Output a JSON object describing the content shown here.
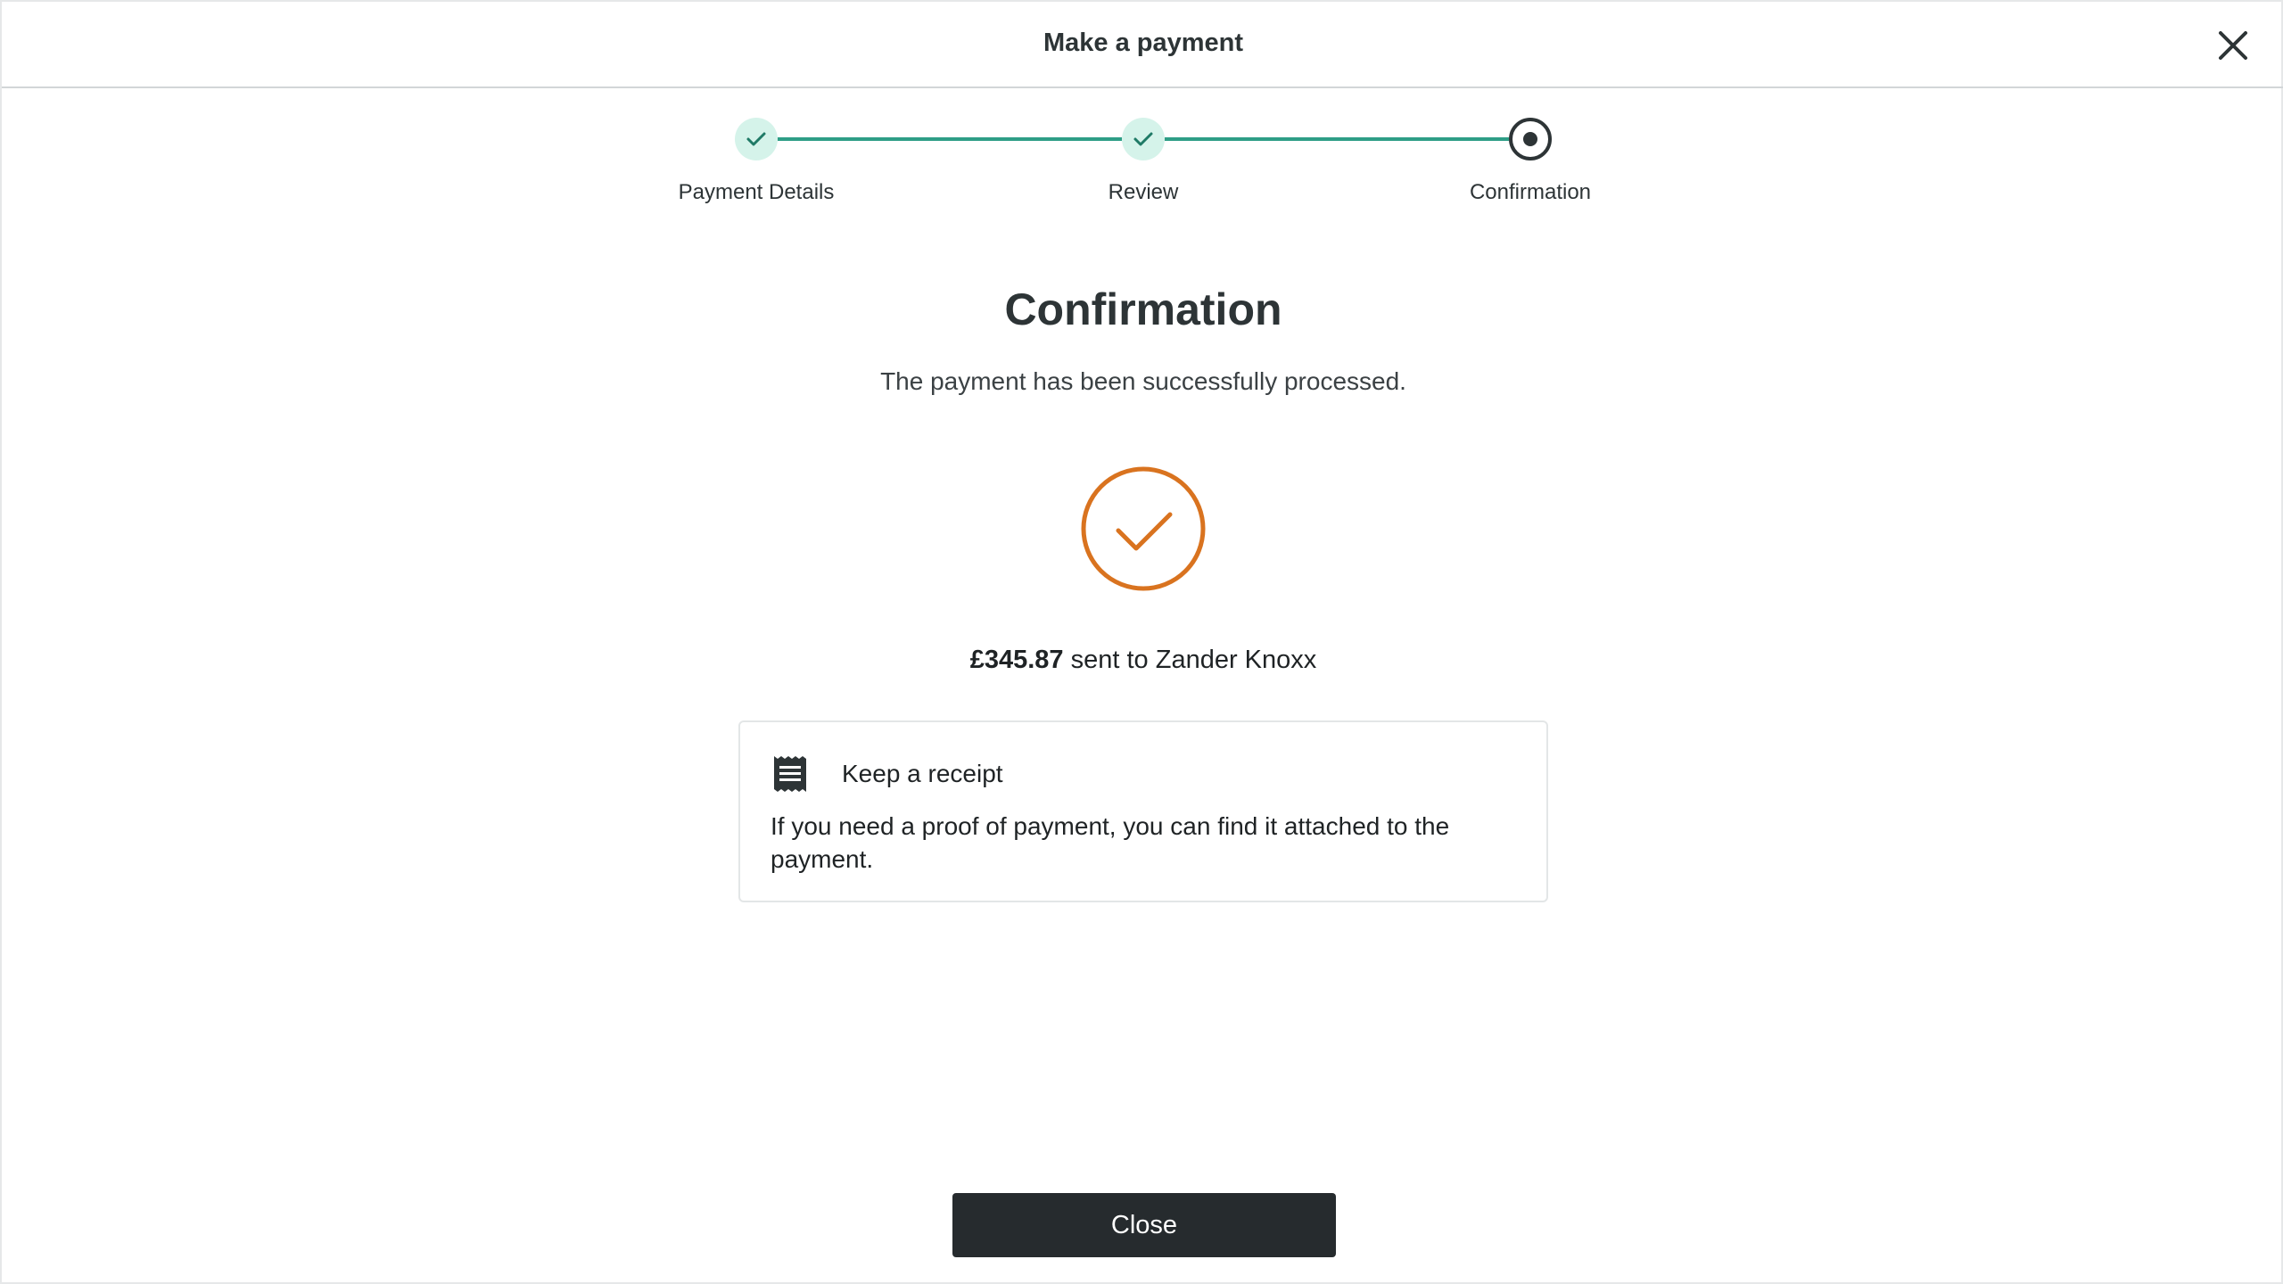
{
  "header": {
    "title": "Make a payment",
    "close_icon": "close-icon"
  },
  "stepper": {
    "steps": [
      {
        "label": "Payment Details",
        "state": "complete"
      },
      {
        "label": "Review",
        "state": "complete"
      },
      {
        "label": "Confirmation",
        "state": "current"
      }
    ]
  },
  "main": {
    "title": "Confirmation",
    "subtitle": "The payment has been successfully processed.",
    "amount": "£345.87",
    "sent_to_text": "sent to Zander Knoxx"
  },
  "receipt": {
    "icon": "receipt-icon",
    "title": "Keep a receipt",
    "text": "If you need a proof of payment, you can find it attached to the payment."
  },
  "footer": {
    "close_label": "Close"
  },
  "colors": {
    "accent_green": "#2e9e86",
    "success_orange": "#d9731f",
    "dark": "#262b2e"
  }
}
